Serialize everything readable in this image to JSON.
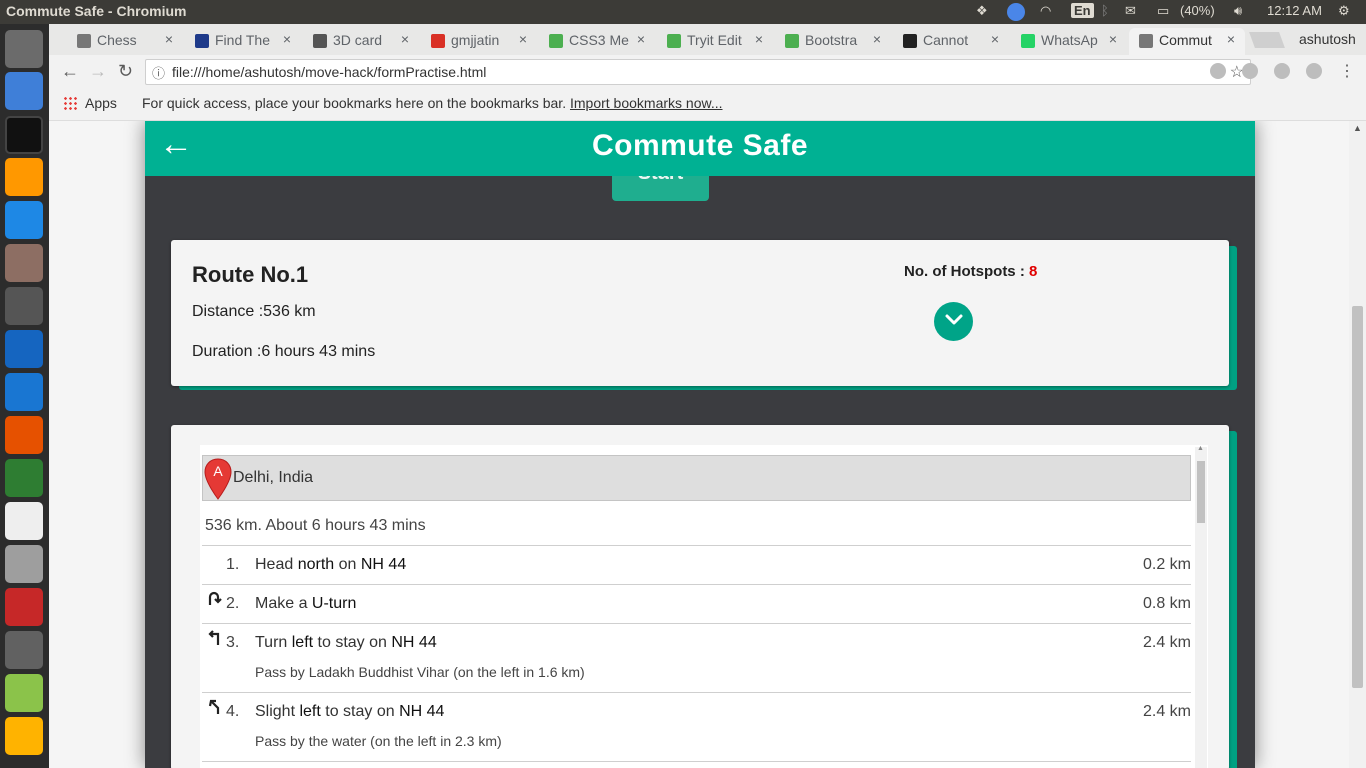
{
  "os": {
    "window_title": "Commute Safe - Chromium",
    "language": "En",
    "battery": "(40%)",
    "time": "12:12 AM",
    "user": "ashutosh"
  },
  "tabs": [
    {
      "label": "Chess",
      "icon": "page-icon",
      "color": "#777777"
    },
    {
      "label": "Find The",
      "icon": "site-icon",
      "color": "#1e3a8a"
    },
    {
      "label": "3D card",
      "icon": "css3-icon",
      "color": "#555555"
    },
    {
      "label": "gmjjatin",
      "icon": "gmail-icon",
      "color": "#d93025"
    },
    {
      "label": "CSS3 Me",
      "icon": "w3schools-icon",
      "color": "#4caf50"
    },
    {
      "label": "Tryit Edit",
      "icon": "w3schools-icon",
      "color": "#4caf50"
    },
    {
      "label": "Bootstra",
      "icon": "w3schools-icon",
      "color": "#4caf50"
    },
    {
      "label": "Cannot",
      "icon": "github-icon",
      "color": "#222222"
    },
    {
      "label": "WhatsAp",
      "icon": "whatsapp-icon",
      "color": "#25d366"
    },
    {
      "label": "Commut",
      "icon": "page-icon",
      "color": "#777777",
      "active": true
    }
  ],
  "browser": {
    "url": "file:///home/ashutosh/move-hack/formPractise.html",
    "bookmarks_apps": "Apps",
    "bookmarks_hint": "For quick access, place your bookmarks here on the bookmarks bar.",
    "bookmarks_link": "Import bookmarks now..."
  },
  "app": {
    "title": "Commute Safe",
    "start_label": "Start",
    "accent": "#00b193",
    "route": {
      "title": "Route No.1",
      "distance": "Distance :536 km",
      "duration": "Duration :6 hours 43 mins",
      "hotspots_label": "No. of Hotspots : ",
      "hotspots_count": "8",
      "hotspot_color": "#e00000"
    },
    "directions": {
      "origin_marker": "A",
      "origin": "Delhi, India",
      "summary": "536 km. About 6 hours 43 mins",
      "steps": [
        {
          "num": "1.",
          "parts": [
            "Head ",
            "north",
            " on ",
            "NH 44"
          ],
          "distance": "0.2 km",
          "note": "",
          "turn": ""
        },
        {
          "num": "2.",
          "parts": [
            "Make a ",
            "U-turn",
            "",
            ""
          ],
          "distance": "0.8 km",
          "note": "",
          "turn": "uturn-icon"
        },
        {
          "num": "3.",
          "parts": [
            "Turn ",
            "left",
            " to stay on ",
            "NH 44"
          ],
          "distance": "2.4 km",
          "note": "Pass by Ladakh Buddhist Vihar (on the left in 1.6 km)",
          "turn": "turn-left-icon"
        },
        {
          "num": "4.",
          "parts": [
            "Slight ",
            "left",
            " to stay on ",
            "NH 44"
          ],
          "distance": "2.4 km",
          "note": "Pass by the water (on the left in 2.3 km)",
          "turn": "slight-left-icon"
        }
      ]
    }
  }
}
